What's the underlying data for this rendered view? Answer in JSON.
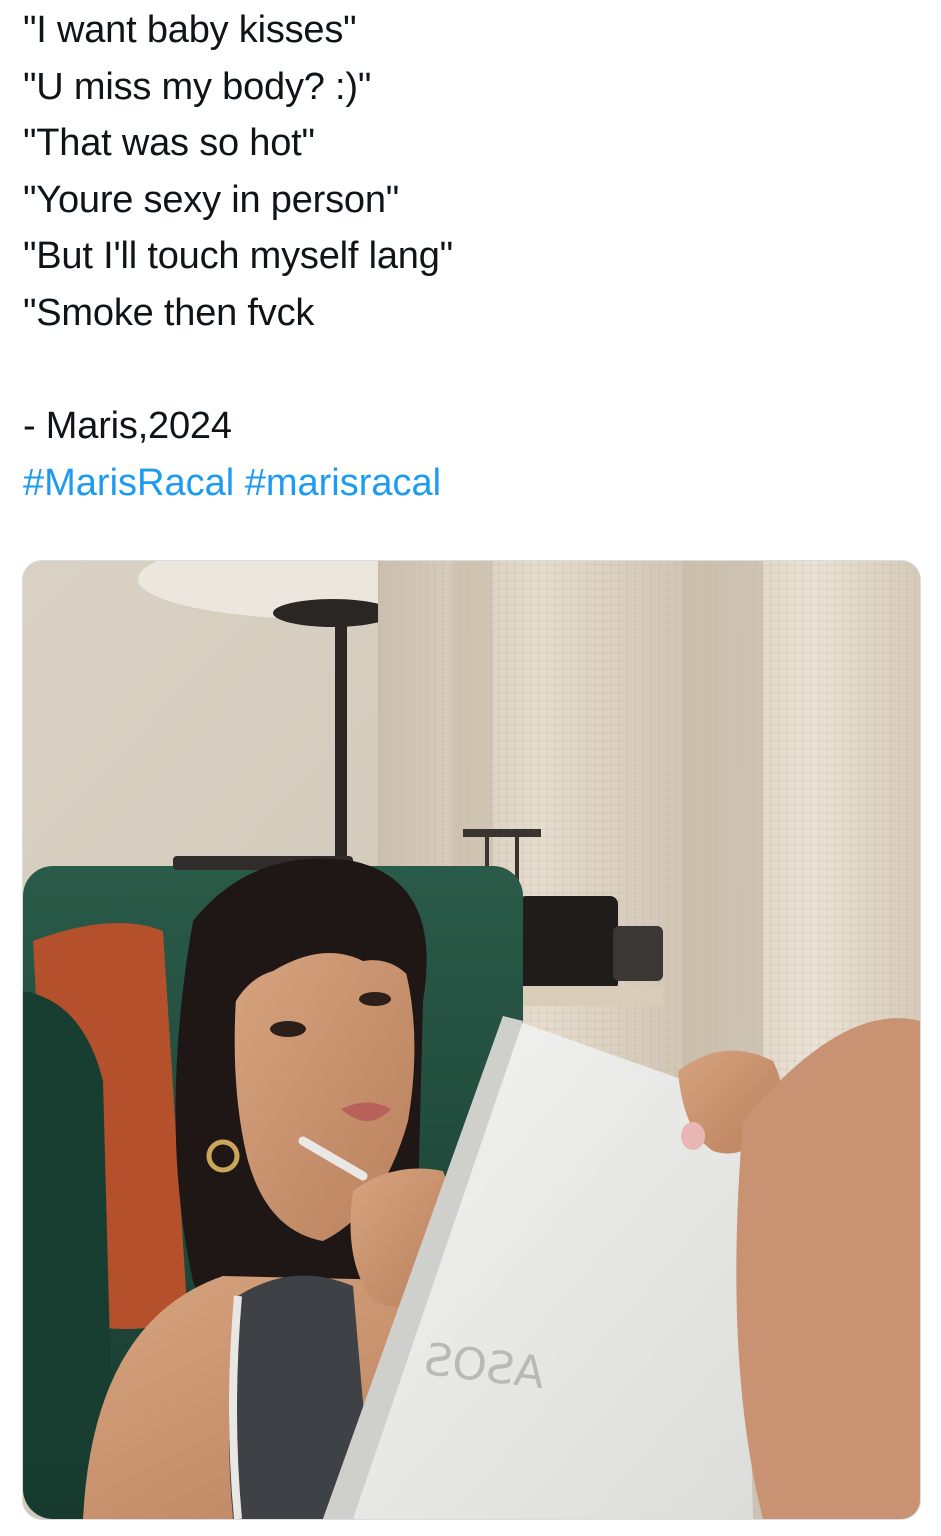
{
  "tweet": {
    "lines": [
      "\"I want baby kisses\"",
      "\"U miss my body? :)\"",
      "\"That was so hot\"",
      "\"Youre sexy in person\"",
      "\"But I'll touch myself lang\"",
      "\"Smoke then fvck"
    ],
    "signature": "- Maris,2024",
    "hashtags": [
      "#MarisRacal",
      "#marisracal"
    ]
  },
  "media": {
    "notebook_brand": "ASOS"
  },
  "colors": {
    "text": "#0f1419",
    "hashtag": "#1d9bf0",
    "sofa": "#1f4a3c",
    "pillow": "#b4502c",
    "curtain": "#d9cfc0"
  }
}
